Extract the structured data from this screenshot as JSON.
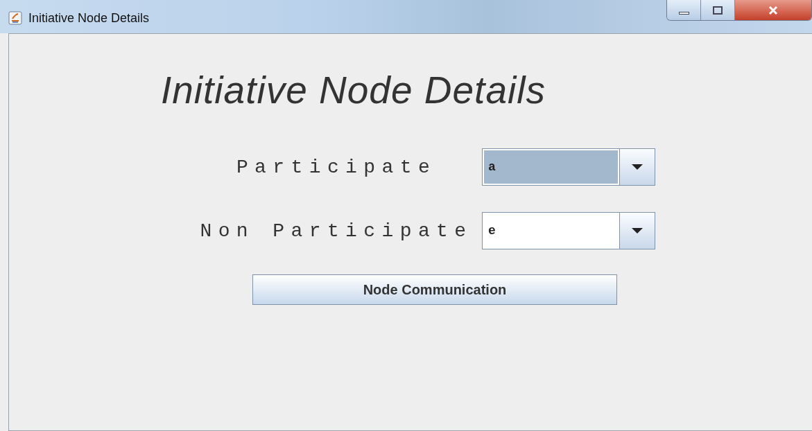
{
  "window": {
    "title": "Initiative Node Details"
  },
  "heading": "Initiative Node Details",
  "fields": [
    {
      "label": "Participate",
      "value": "a",
      "focused": true
    },
    {
      "label": "Non Participate",
      "value": "e",
      "focused": false
    }
  ],
  "button": "Node Communication"
}
